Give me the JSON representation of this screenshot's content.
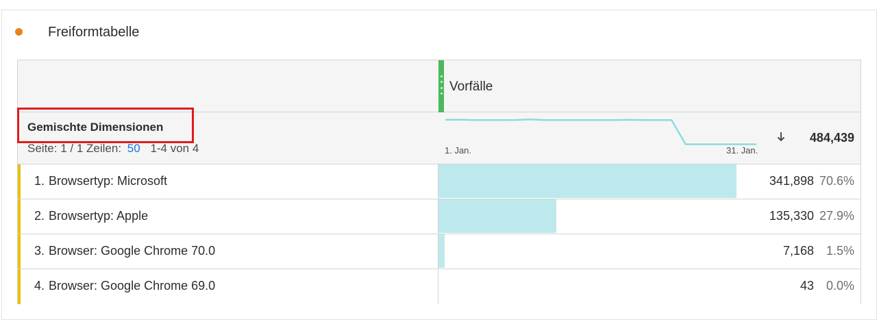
{
  "panel": {
    "title": "Freiformtabelle",
    "status_color": "#e68619"
  },
  "table": {
    "metric_column": {
      "name": "Vorfälle",
      "handle_color": "#4cb85c"
    },
    "dimension_header": {
      "title": "Gemischte Dimensionen",
      "page_label": "Seite: 1 / 1",
      "rows_label": "Zeilen:",
      "rows_value": "50",
      "range_label": "1-4 von 4"
    },
    "trend": {
      "start_label": "1. Jan.",
      "end_label": "31. Jan.",
      "line_color": "#8fdada",
      "values": [
        24.2,
        24.4,
        24.0,
        24.0,
        24.0,
        24.1,
        24.6,
        24.0,
        24.0,
        24.0,
        24.0,
        24.0,
        24.0,
        24.2,
        24.0,
        24.0,
        24.0,
        2.1,
        2.1,
        2.1,
        2.1,
        2.1,
        2.1
      ]
    },
    "sort_icon": "arrow-down-icon",
    "total": "484,439",
    "rows": [
      {
        "num": "1.",
        "label": "Browsertyp: Microsoft",
        "value": "341,898",
        "pct": "70.6%",
        "share": 0.706
      },
      {
        "num": "2.",
        "label": "Browsertyp: Apple",
        "value": "135,330",
        "pct": "27.9%",
        "share": 0.279
      },
      {
        "num": "3.",
        "label": "Browser: Google Chrome 70.0",
        "value": "7,168",
        "pct": "1.5%",
        "share": 0.015
      },
      {
        "num": "4.",
        "label": "Browser: Google Chrome 69.0",
        "value": "43",
        "pct": "0.0%",
        "share": 0.0
      }
    ],
    "bar_color": "#bde9ec",
    "row_accent_color": "#e6c200"
  }
}
